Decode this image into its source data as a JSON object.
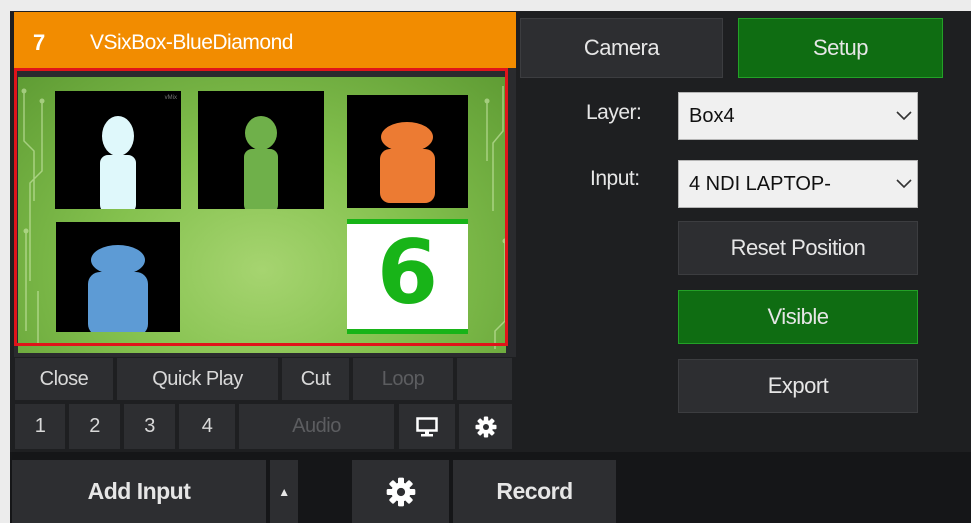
{
  "input": {
    "number": "7",
    "name": "VSixBox-BlueDiamond"
  },
  "preview": {
    "tile1_mark": "vMix",
    "tile6_digit": "6",
    "colors": {
      "tile1": "#dff8fb",
      "tile2": "#6fb04a",
      "tile3": "#ec7b33",
      "tile4": "#5d9bd5",
      "tile6": "#18b418"
    }
  },
  "controls": {
    "close": "Close",
    "quick_play": "Quick Play",
    "cut": "Cut",
    "loop": "Loop",
    "n1": "1",
    "n2": "2",
    "n3": "3",
    "n4": "4",
    "audio": "Audio",
    "monitor_icon": "monitor-icon",
    "settings_icon": "gear-icon"
  },
  "bottom": {
    "add_input": "Add Input",
    "arrow": "▲",
    "settings_icon": "gear-icon",
    "record": "Record"
  },
  "panel": {
    "camera": "Camera",
    "setup": "Setup",
    "layer_label": "Layer:",
    "layer_value": "Box4",
    "input_label": "Input:",
    "input_value": "4 NDI LAPTOP-",
    "reset_position": "Reset Position",
    "visible": "Visible",
    "export": "Export"
  },
  "colors": {
    "title_orange": "#f28c00",
    "active_green": "#0f6d12",
    "highlight_red": "#e0141a"
  }
}
